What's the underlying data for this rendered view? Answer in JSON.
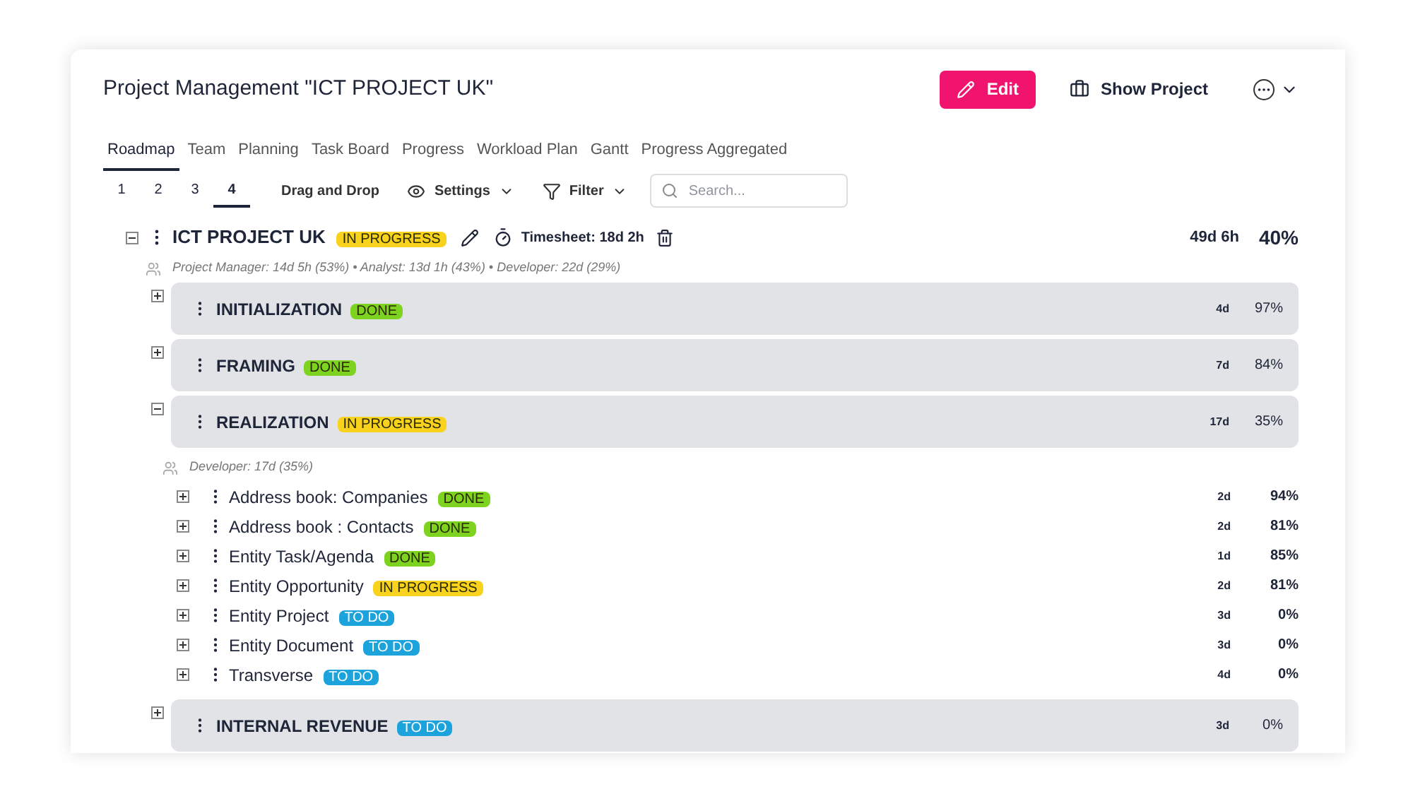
{
  "header": {
    "title": "Project Management \"ICT PROJECT UK\"",
    "edit_button": "Edit",
    "show_project_button": "Show Project"
  },
  "tabs": [
    {
      "label": "Roadmap",
      "selected": true
    },
    {
      "label": "Team",
      "selected": false
    },
    {
      "label": "Planning",
      "selected": false
    },
    {
      "label": "Task Board",
      "selected": false
    },
    {
      "label": "Progress",
      "selected": false
    },
    {
      "label": "Workload Plan",
      "selected": false
    },
    {
      "label": "Gantt",
      "selected": false
    },
    {
      "label": "Progress Aggregated",
      "selected": false
    }
  ],
  "levels": [
    {
      "label": "1",
      "selected": false
    },
    {
      "label": "2",
      "selected": false
    },
    {
      "label": "3",
      "selected": false
    },
    {
      "label": "4",
      "selected": true
    }
  ],
  "toolbar": {
    "drag_and_drop": "Drag and Drop",
    "settings": "Settings",
    "filter": "Filter",
    "search": {
      "placeholder": "Search..."
    }
  },
  "project": {
    "name": "ICT PROJECT UK",
    "status": "IN PROGRESS",
    "color": "#f8d21c",
    "expanded": true,
    "timesheet": "Timesheet: 18d 2h",
    "duration": "49d 6h",
    "percent": "40%",
    "roles": "Project Manager: 14d 5h (53%) • Analyst: 13d 1h (43%) • Developer: 22d (29%)",
    "phases": [
      {
        "name": "INITIALIZATION",
        "status": "DONE",
        "color": "#7ed321",
        "expanded": false,
        "duration": "4d",
        "percent": "97%"
      },
      {
        "name": "FRAMING",
        "status": "DONE",
        "color": "#7ed321",
        "expanded": false,
        "duration": "7d",
        "percent": "84%"
      },
      {
        "name": "REALIZATION",
        "status": "IN PROGRESS",
        "color": "#f8d21c",
        "expanded": true,
        "duration": "17d",
        "percent": "35%",
        "roles": "Developer: 17d (35%)",
        "tasks": [
          {
            "name": "Address book: Companies",
            "status": "DONE",
            "color": "#7ed321",
            "expanded": false,
            "duration": "2d",
            "percent": "94%"
          },
          {
            "name": "Address book : Contacts",
            "status": "DONE",
            "color": "#7ed321",
            "expanded": false,
            "duration": "2d",
            "percent": "81%"
          },
          {
            "name": "Entity Task/Agenda",
            "status": "DONE",
            "color": "#7ed321",
            "expanded": false,
            "duration": "1d",
            "percent": "85%"
          },
          {
            "name": "Entity Opportunity",
            "status": "IN PROGRESS",
            "color": "#f8d21c",
            "expanded": false,
            "duration": "2d",
            "percent": "81%"
          },
          {
            "name": "Entity Project",
            "status": "TO DO",
            "color": "#1ca3dc",
            "expanded": false,
            "duration": "3d",
            "percent": "0%"
          },
          {
            "name": "Entity Document",
            "status": "TO DO",
            "color": "#1ca3dc",
            "expanded": false,
            "duration": "3d",
            "percent": "0%"
          },
          {
            "name": "Transverse",
            "status": "TO DO",
            "color": "#1ca3dc",
            "expanded": false,
            "duration": "4d",
            "percent": "0%"
          }
        ]
      },
      {
        "name": "INTERNAL REVENUE",
        "status": "TO DO",
        "color": "#1ca3dc",
        "expanded": false,
        "duration": "3d",
        "percent": "0%"
      }
    ]
  }
}
